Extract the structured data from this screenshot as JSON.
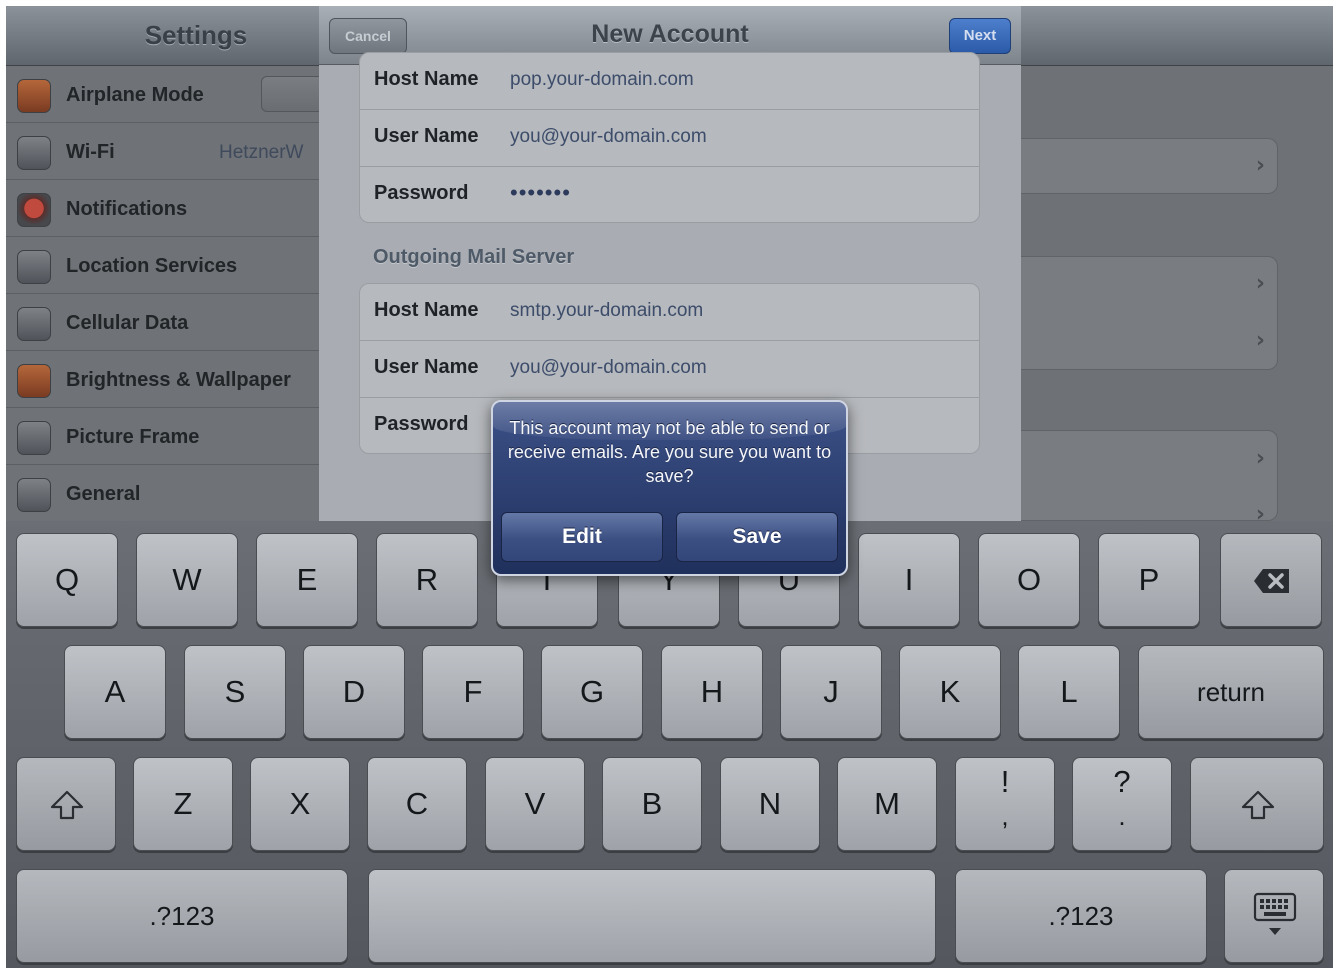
{
  "settings": {
    "title": "Settings",
    "items": [
      {
        "label": "Airplane Mode",
        "value": ""
      },
      {
        "label": "Wi-Fi",
        "value": "HetznerW"
      },
      {
        "label": "Notifications",
        "value": ""
      },
      {
        "label": "Location Services",
        "value": ""
      },
      {
        "label": "Cellular Data",
        "value": ""
      },
      {
        "label": "Brightness & Wallpaper",
        "value": ""
      },
      {
        "label": "Picture Frame",
        "value": ""
      },
      {
        "label": "General",
        "value": ""
      }
    ],
    "chevron": "›"
  },
  "sheet": {
    "title": "New Account",
    "cancel": "Cancel",
    "next": "Next",
    "incoming": {
      "rows": [
        {
          "label": "Host Name",
          "value": "pop.your-domain.com"
        },
        {
          "label": "User Name",
          "value": "you@your-domain.com"
        },
        {
          "label": "Password",
          "value": "•••••••"
        }
      ]
    },
    "outgoing": {
      "header": "Outgoing Mail Server",
      "rows": [
        {
          "label": "Host Name",
          "value": "smtp.your-domain.com"
        },
        {
          "label": "User Name",
          "value": "you@your-domain.com"
        },
        {
          "label": "Password",
          "value": ""
        }
      ]
    }
  },
  "alert": {
    "message": "This account may not be able to send or receive emails. Are you sure you want to save?",
    "edit": "Edit",
    "save": "Save"
  },
  "keyboard": {
    "row1": [
      "Q",
      "W",
      "E",
      "R",
      "T",
      "Y",
      "U",
      "I",
      "O",
      "P"
    ],
    "row2": [
      "A",
      "S",
      "D",
      "F",
      "G",
      "H",
      "J",
      "K",
      "L"
    ],
    "return": "return",
    "row3": [
      "Z",
      "X",
      "C",
      "V",
      "B",
      "N",
      "M"
    ],
    "punct1": {
      "top": "!",
      "bottom": ","
    },
    "punct2": {
      "top": "?",
      "bottom": "."
    },
    "numbers_left": ".?123",
    "numbers_right": ".?123",
    "icons": {
      "delete": "delete-icon",
      "shift": "shift-icon",
      "hide": "keyboard-hide-icon"
    }
  },
  "colors": {
    "alert_blue": "#2b3b6e",
    "next_blue": "#3a6cbd",
    "key_face": "#b3b7bc"
  }
}
